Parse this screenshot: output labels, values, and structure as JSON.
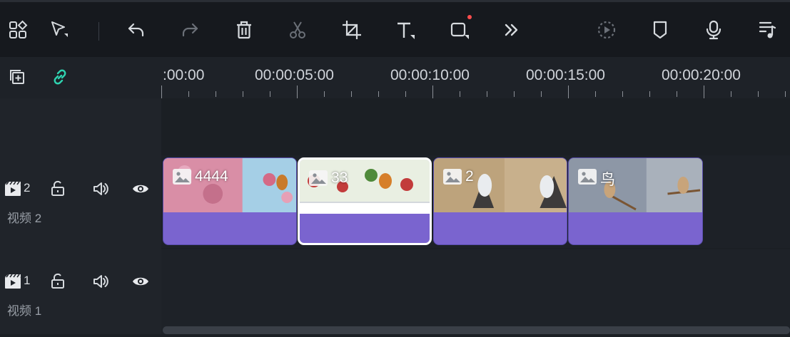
{
  "toolbar": {
    "items": [
      {
        "name": "layout-grid-icon"
      },
      {
        "name": "select-cursor-icon"
      },
      {
        "name": "undo-icon"
      },
      {
        "name": "redo-icon"
      },
      {
        "name": "delete-icon"
      },
      {
        "name": "cut-icon"
      },
      {
        "name": "crop-icon"
      },
      {
        "name": "text-icon"
      },
      {
        "name": "shape-icon",
        "badge": true
      },
      {
        "name": "more-chevrons-icon"
      },
      {
        "name": "speed-play-icon"
      },
      {
        "name": "marker-icon"
      },
      {
        "name": "microphone-icon"
      },
      {
        "name": "audio-list-icon"
      }
    ],
    "badge_color": "#ff4d4d"
  },
  "ruler": {
    "labels": [
      ":00:00",
      "00:00:05:00",
      "00:00:10:00",
      "00:00:15:00",
      "00:00:20:00"
    ]
  },
  "tracks": [
    {
      "number": "2",
      "name": "视频 2"
    },
    {
      "number": "1",
      "name": "视频 1"
    }
  ],
  "clips": [
    {
      "label": "4444",
      "selected": false
    },
    {
      "label": "33",
      "selected": true
    },
    {
      "label": "2",
      "selected": false
    },
    {
      "label": "鸟",
      "selected": false
    }
  ],
  "colors": {
    "clip_bar": "#7a64cf",
    "link_icon": "#2fd3b0",
    "background": "#1b1f24"
  }
}
